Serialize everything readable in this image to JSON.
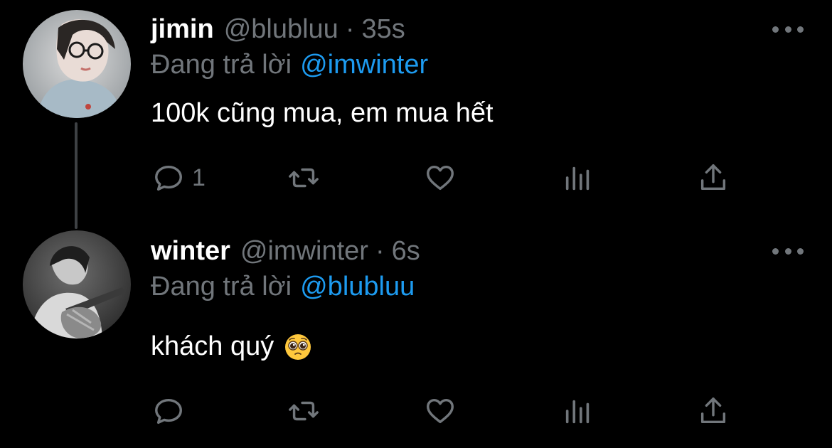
{
  "colors": {
    "background": "#000000",
    "name": "#FFFFFF",
    "secondary": "#71767B",
    "mention": "#1D9BF0",
    "thread_line": "#3E4144"
  },
  "tweets": [
    {
      "name": "jimin",
      "handle": "@blubluu",
      "separator": "·",
      "time": "35s",
      "replying_prefix": "Đang trả lời",
      "replying_to": "@imwinter",
      "text": "100k cũng mua, em mua hết",
      "emoji": "",
      "reply_count": "1",
      "icons": [
        "avatar",
        "more-icon",
        "reply-icon",
        "retweet-icon",
        "like-icon",
        "stats-icon",
        "share-icon"
      ]
    },
    {
      "name": "winter",
      "handle": "@imwinter",
      "separator": "·",
      "time": "6s",
      "replying_prefix": "Đang trả lời",
      "replying_to": "@blubluu",
      "text": "khách quý",
      "emoji": "pleading-face-emoji",
      "reply_count": "",
      "icons": [
        "avatar",
        "more-icon",
        "reply-icon",
        "retweet-icon",
        "like-icon",
        "stats-icon",
        "share-icon"
      ]
    }
  ]
}
